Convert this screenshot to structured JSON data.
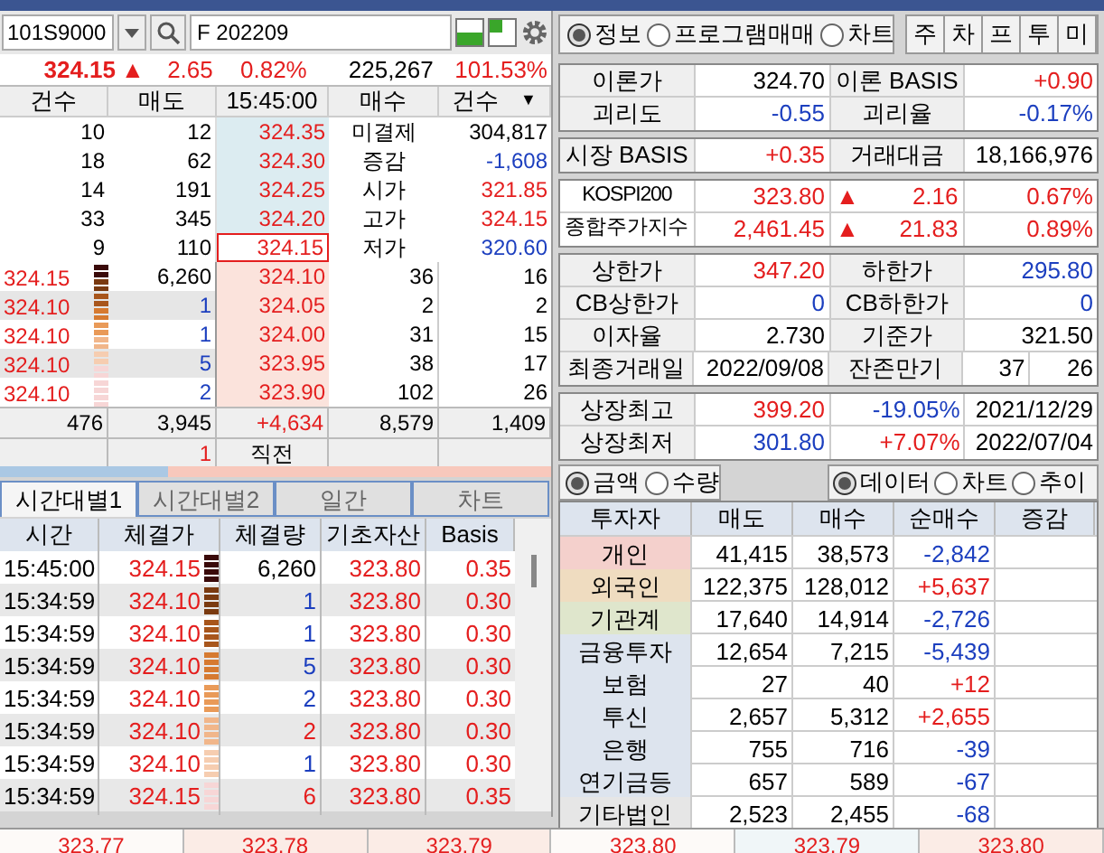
{
  "code_field": {
    "value": "101S9000"
  },
  "name_field": {
    "value": "F 202209"
  },
  "quote": {
    "price": "324.15",
    "arrow": "▲",
    "change": "2.65",
    "rate": "0.82%",
    "volume": "225,267",
    "ratio": "101.53%"
  },
  "orderbook": {
    "headers": [
      "건수",
      "매도",
      "15:45:00",
      "매수",
      "건수"
    ],
    "header_menu": "▼",
    "asks": [
      {
        "count": "10",
        "qty": "12",
        "price": "324.35",
        "selected": false,
        "label": "미결제",
        "value": "304,817",
        "color": "#000000"
      },
      {
        "count": "18",
        "qty": "62",
        "price": "324.30",
        "selected": false,
        "label": "증감",
        "value": "-1,608",
        "color": "#1c3fbf"
      },
      {
        "count": "14",
        "qty": "191",
        "price": "324.25",
        "selected": false,
        "label": "시가",
        "value": "321.85",
        "color": "#e41e1e"
      },
      {
        "count": "33",
        "qty": "345",
        "price": "324.20",
        "selected": false,
        "label": "고가",
        "value": "324.15",
        "color": "#e41e1e"
      },
      {
        "count": "9",
        "qty": "110",
        "price": "324.15",
        "selected": true,
        "label": "저가",
        "value": "320.60",
        "color": "#1c3fbf"
      }
    ],
    "bids": [
      {
        "tick_price": "324.15",
        "tick_qty": {
          "text": "6,260",
          "color": "#000000"
        },
        "price": "324.10",
        "qty": "36",
        "count": "16"
      },
      {
        "tick_price": "324.10",
        "tick_qty": {
          "text": "1",
          "color": "#1c3fbf"
        },
        "price": "324.05",
        "qty": "2",
        "count": "2"
      },
      {
        "tick_price": "324.10",
        "tick_qty": {
          "text": "1",
          "color": "#1c3fbf"
        },
        "price": "324.00",
        "qty": "31",
        "count": "15"
      },
      {
        "tick_price": "324.10",
        "tick_qty": {
          "text": "5",
          "color": "#1c3fbf"
        },
        "price": "323.95",
        "qty": "38",
        "count": "17"
      },
      {
        "tick_price": "324.10",
        "tick_qty": {
          "text": "2",
          "color": "#1c3fbf"
        },
        "price": "323.90",
        "qty": "102",
        "count": "26"
      }
    ],
    "totals": [
      "476",
      "3,945",
      "+4,634",
      "8,579",
      "1,409"
    ],
    "prev_count": "1",
    "prev_label": "직전"
  },
  "tabs": [
    {
      "label": "시간대별1",
      "selected": true
    },
    {
      "label": "시간대별2",
      "selected": false
    },
    {
      "label": "일간",
      "selected": false
    },
    {
      "label": "차트",
      "selected": false
    }
  ],
  "ticks": {
    "columns": [
      "시간",
      "체결가",
      "체결량",
      "기초자산",
      "Basis"
    ],
    "rows": [
      {
        "time": "15:45:00",
        "price": "324.15",
        "qty": {
          "text": "6,260",
          "color": "#000000"
        },
        "base": "323.80",
        "basis": "0.35"
      },
      {
        "time": "15:34:59",
        "price": "324.10",
        "qty": {
          "text": "1",
          "color": "#1c3fbf"
        },
        "base": "323.80",
        "basis": "0.30"
      },
      {
        "time": "15:34:59",
        "price": "324.10",
        "qty": {
          "text": "1",
          "color": "#1c3fbf"
        },
        "base": "323.80",
        "basis": "0.30"
      },
      {
        "time": "15:34:59",
        "price": "324.10",
        "qty": {
          "text": "5",
          "color": "#1c3fbf"
        },
        "base": "323.80",
        "basis": "0.30"
      },
      {
        "time": "15:34:59",
        "price": "324.10",
        "qty": {
          "text": "2",
          "color": "#1c3fbf"
        },
        "base": "323.80",
        "basis": "0.30"
      },
      {
        "time": "15:34:59",
        "price": "324.10",
        "qty": {
          "text": "2",
          "color": "#e41e1e"
        },
        "base": "323.80",
        "basis": "0.30"
      },
      {
        "time": "15:34:59",
        "price": "324.10",
        "qty": {
          "text": "1",
          "color": "#1c3fbf"
        },
        "base": "323.80",
        "basis": "0.30"
      },
      {
        "time": "15:34:59",
        "price": "324.15",
        "qty": {
          "text": "6",
          "color": "#e41e1e"
        },
        "base": "323.80",
        "basis": "0.35"
      }
    ]
  },
  "view_radios": [
    {
      "label": "정보",
      "selected": true
    },
    {
      "label": "프로그램매매",
      "selected": false
    },
    {
      "label": "차트",
      "selected": false
    }
  ],
  "shortcut_buttons": [
    "주",
    "차",
    "프",
    "투",
    "미"
  ],
  "info_groups": [
    [
      {
        "cells": [
          {
            "kind": "label",
            "text": "이론가"
          },
          {
            "kind": "value",
            "text": "324.70",
            "color": "#000000"
          },
          {
            "kind": "label",
            "text": "이론 BASIS"
          },
          {
            "kind": "value",
            "text": "+0.90",
            "color": "#e41e1e"
          }
        ]
      },
      {
        "cells": [
          {
            "kind": "label",
            "text": "괴리도"
          },
          {
            "kind": "value",
            "text": "-0.55",
            "color": "#1c3fbf"
          },
          {
            "kind": "label",
            "text": "괴리율"
          },
          {
            "kind": "value",
            "text": "-0.17%",
            "color": "#1c3fbf"
          }
        ]
      }
    ],
    [
      {
        "cells": [
          {
            "kind": "label",
            "text": "시장 BASIS"
          },
          {
            "kind": "value",
            "text": "+0.35",
            "color": "#e41e1e"
          },
          {
            "kind": "label",
            "text": "거래대금"
          },
          {
            "kind": "value",
            "text": "18,166,976",
            "color": "#000000"
          }
        ]
      }
    ],
    [
      {
        "cells": [
          {
            "kind": "plain",
            "text": "KOSPI200"
          },
          {
            "kind": "value",
            "text": "323.80",
            "color": "#e41e1e"
          },
          {
            "kind": "change",
            "arrow": "▲",
            "text": "2.16",
            "color": "#e41e1e"
          },
          {
            "kind": "value",
            "text": "0.67%",
            "color": "#e41e1e"
          }
        ]
      },
      {
        "cells": [
          {
            "kind": "plain",
            "text": "종합주가지수"
          },
          {
            "kind": "value",
            "text": "2,461.45",
            "color": "#e41e1e"
          },
          {
            "kind": "change",
            "arrow": "▲",
            "text": "21.83",
            "color": "#e41e1e"
          },
          {
            "kind": "value",
            "text": "0.89%",
            "color": "#e41e1e"
          }
        ]
      }
    ],
    [
      {
        "cells": [
          {
            "kind": "label",
            "text": "상한가"
          },
          {
            "kind": "value",
            "text": "347.20",
            "color": "#e41e1e"
          },
          {
            "kind": "label",
            "text": "하한가"
          },
          {
            "kind": "value",
            "text": "295.80",
            "color": "#1c3fbf"
          }
        ]
      },
      {
        "cells": [
          {
            "kind": "label",
            "text": "CB상한가"
          },
          {
            "kind": "value",
            "text": "0",
            "color": "#1c3fbf"
          },
          {
            "kind": "label",
            "text": "CB하한가"
          },
          {
            "kind": "value",
            "text": "0",
            "color": "#1c3fbf"
          }
        ]
      },
      {
        "cells": [
          {
            "kind": "label",
            "text": "이자율"
          },
          {
            "kind": "value",
            "text": "2.730",
            "color": "#000000"
          },
          {
            "kind": "label",
            "text": "기준가"
          },
          {
            "kind": "value",
            "text": "321.50",
            "color": "#000000"
          }
        ]
      },
      {
        "cells": [
          {
            "kind": "label",
            "text": "최종거래일"
          },
          {
            "kind": "value",
            "text": "2022/09/08",
            "color": "#000000"
          },
          {
            "kind": "label",
            "text": "잔존만기"
          },
          {
            "kind": "half",
            "text": "37",
            "color": "#000000"
          },
          {
            "kind": "half",
            "text": "26",
            "color": "#000000"
          }
        ]
      }
    ],
    [
      {
        "cells": [
          {
            "kind": "label",
            "text": "상장최고"
          },
          {
            "kind": "value",
            "text": "399.20",
            "color": "#e41e1e"
          },
          {
            "kind": "value",
            "text": "-19.05%",
            "color": "#1c3fbf"
          },
          {
            "kind": "value",
            "text": "2021/12/29",
            "color": "#000000"
          }
        ]
      },
      {
        "cells": [
          {
            "kind": "label",
            "text": "상장최저"
          },
          {
            "kind": "value",
            "text": "301.80",
            "color": "#1c3fbf"
          },
          {
            "kind": "value",
            "text": "+7.07%",
            "color": "#e41e1e"
          },
          {
            "kind": "value",
            "text": "2022/07/04",
            "color": "#000000"
          }
        ]
      }
    ]
  ],
  "unit_radios": [
    {
      "label": "금액",
      "selected": true
    },
    {
      "label": "수량",
      "selected": false
    }
  ],
  "mode_radios": [
    {
      "label": "데이터",
      "selected": true
    },
    {
      "label": "차트",
      "selected": false
    },
    {
      "label": "추이",
      "selected": false
    }
  ],
  "investors": {
    "columns": [
      "투자자",
      "매도",
      "매수",
      "순매수",
      "증감"
    ],
    "rows": [
      {
        "name": "개인",
        "color": "#f4d0cc",
        "sell": "41,415",
        "buy": "38,573",
        "net": {
          "text": "-2,842",
          "color": "#1c3fbf"
        }
      },
      {
        "name": "외국인",
        "color": "#efdcc0",
        "sell": "122,375",
        "buy": "128,012",
        "net": {
          "text": "+5,637",
          "color": "#e41e1e"
        }
      },
      {
        "name": "기관계",
        "color": "#dfe6cc",
        "sell": "17,640",
        "buy": "14,914",
        "net": {
          "text": "-2,726",
          "color": "#1c3fbf"
        }
      },
      {
        "name": "금융투자",
        "color": "#dde4ee",
        "sell": "12,654",
        "buy": "7,215",
        "net": {
          "text": "-5,439",
          "color": "#1c3fbf"
        }
      },
      {
        "name": "보험",
        "color": "#dde4ee",
        "sell": "27",
        "buy": "40",
        "net": {
          "text": "+12",
          "color": "#e41e1e"
        }
      },
      {
        "name": "투신",
        "color": "#dde4ee",
        "sell": "2,657",
        "buy": "5,312",
        "net": {
          "text": "+2,655",
          "color": "#e41e1e"
        }
      },
      {
        "name": "은행",
        "color": "#dde4ee",
        "sell": "755",
        "buy": "716",
        "net": {
          "text": "-39",
          "color": "#1c3fbf"
        }
      },
      {
        "name": "연기금등",
        "color": "#dde4ee",
        "sell": "657",
        "buy": "589",
        "net": {
          "text": "-67",
          "color": "#1c3fbf"
        }
      },
      {
        "name": "기타법인",
        "color": "#e6e6e6",
        "sell": "2,523",
        "buy": "2,455",
        "net": {
          "text": "-68",
          "color": "#1c3fbf"
        }
      }
    ]
  },
  "footer_values": [
    "323.77",
    "323.78",
    "323.79",
    "323.80",
    "323.79",
    "323.80"
  ]
}
